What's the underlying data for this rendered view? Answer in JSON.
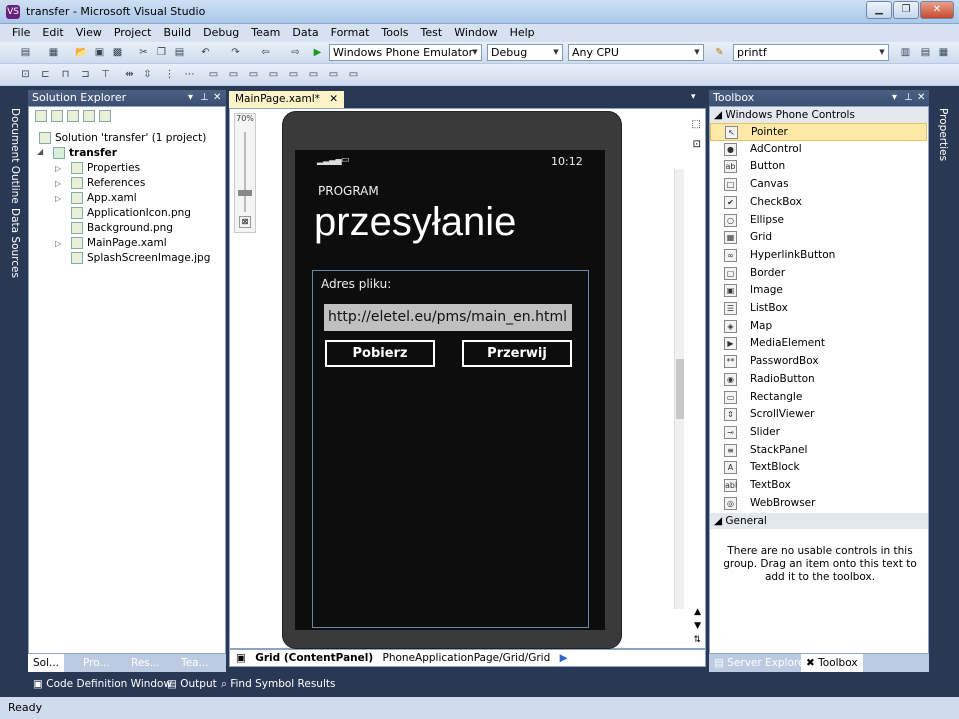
{
  "window": {
    "title": "transfer - Microsoft Visual Studio",
    "app_icon": "VS"
  },
  "menu": [
    "File",
    "Edit",
    "View",
    "Project",
    "Build",
    "Debug",
    "Team",
    "Data",
    "Format",
    "Tools",
    "Test",
    "Window",
    "Help"
  ],
  "toolbar": {
    "target_device": "Windows Phone Emulator",
    "configuration": "Debug",
    "platform": "Any CPU",
    "find_text": "printf"
  },
  "solution_explorer": {
    "title": "Solution Explorer",
    "solution": "Solution 'transfer' (1 project)",
    "project": "transfer",
    "items": [
      "Properties",
      "References",
      "App.xaml",
      "ApplicationIcon.png",
      "Background.png",
      "MainPage.xaml",
      "SplashScreenImage.jpg"
    ],
    "tabs": [
      "Sol...",
      "Pro...",
      "Res...",
      "Tea..."
    ]
  },
  "left_vertical_tabs": [
    "Document Outline",
    "Data Sources"
  ],
  "right_vertical_tabs": [
    "Properties"
  ],
  "editor": {
    "tab": "MainPage.xaml*",
    "zoom": "70%",
    "breadcrumb_element": "Grid (ContentPanel)",
    "breadcrumb_path": "PhoneApplicationPage/Grid/Grid"
  },
  "phone": {
    "time": "10:12",
    "app_title": "PROGRAM",
    "page_title": "przesyłanie",
    "label": "Adres pliku:",
    "url_value": "http://eletel.eu/pms/main_en.html",
    "button_download": "Pobierz",
    "button_abort": "Przerwij"
  },
  "toolbox": {
    "title": "Toolbox",
    "group": "Windows Phone Controls",
    "controls": [
      {
        "name": "Pointer",
        "icon": "pointer-icon",
        "glyph": "↖"
      },
      {
        "name": "AdControl",
        "icon": "adcontrol-icon",
        "glyph": "●"
      },
      {
        "name": "Button",
        "icon": "button-icon",
        "glyph": "ab"
      },
      {
        "name": "Canvas",
        "icon": "canvas-icon",
        "glyph": "□"
      },
      {
        "name": "CheckBox",
        "icon": "checkbox-icon",
        "glyph": "✔"
      },
      {
        "name": "Ellipse",
        "icon": "ellipse-icon",
        "glyph": "○"
      },
      {
        "name": "Grid",
        "icon": "grid-icon",
        "glyph": "▦"
      },
      {
        "name": "HyperlinkButton",
        "icon": "hyperlink-icon",
        "glyph": "∞"
      },
      {
        "name": "Border",
        "icon": "border-icon",
        "glyph": "▢"
      },
      {
        "name": "Image",
        "icon": "image-icon",
        "glyph": "▣"
      },
      {
        "name": "ListBox",
        "icon": "listbox-icon",
        "glyph": "☰"
      },
      {
        "name": "Map",
        "icon": "map-icon",
        "glyph": "◈"
      },
      {
        "name": "MediaElement",
        "icon": "media-icon",
        "glyph": "▶"
      },
      {
        "name": "PasswordBox",
        "icon": "password-icon",
        "glyph": "**"
      },
      {
        "name": "RadioButton",
        "icon": "radio-icon",
        "glyph": "◉"
      },
      {
        "name": "Rectangle",
        "icon": "rectangle-icon",
        "glyph": "▭"
      },
      {
        "name": "ScrollViewer",
        "icon": "scrollviewer-icon",
        "glyph": "⇕"
      },
      {
        "name": "Slider",
        "icon": "slider-icon",
        "glyph": "⊸"
      },
      {
        "name": "StackPanel",
        "icon": "stackpanel-icon",
        "glyph": "≡"
      },
      {
        "name": "TextBlock",
        "icon": "textblock-icon",
        "glyph": "A"
      },
      {
        "name": "TextBox",
        "icon": "textbox-icon",
        "glyph": "abl"
      },
      {
        "name": "WebBrowser",
        "icon": "webbrowser-icon",
        "glyph": "◎"
      }
    ],
    "general_group": "General",
    "empty_message": "There are no usable controls in this group. Drag an item onto this text to add it to the toolbox.",
    "tabs": [
      "Server Explorer",
      "Toolbox"
    ]
  },
  "bottom_tabs": [
    "Code Definition Window",
    "Output",
    "Find Symbol Results"
  ],
  "status": "Ready",
  "colors": {
    "vs_frame": "#293955",
    "panel_header": "#4d6082",
    "toolbox_selected": "#fde9a6",
    "phone_bg": "#0d0d0d"
  }
}
